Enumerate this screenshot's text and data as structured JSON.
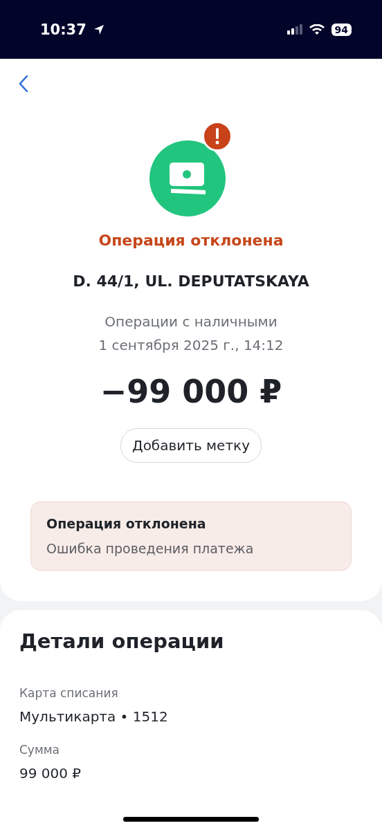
{
  "status_bar": {
    "time": "10:37",
    "battery": "94"
  },
  "header": {
    "status": "Операция отклонена",
    "merchant": "D. 44/1, UL. DEPUTATSKAYA",
    "category": "Операции с наличными",
    "date": "1 сентября 2025 г., 14:12",
    "amount": "−99 000 ₽",
    "tag_button": "Добавить метку"
  },
  "alert": {
    "title": "Операция отклонена",
    "message": "Ошибка проведения платежа"
  },
  "details": {
    "title": "Детали операции",
    "fields": [
      {
        "label": "Карта списания",
        "value": "Мультикарта • 1512"
      },
      {
        "label": "Сумма",
        "value": "99 000 ₽"
      }
    ]
  }
}
